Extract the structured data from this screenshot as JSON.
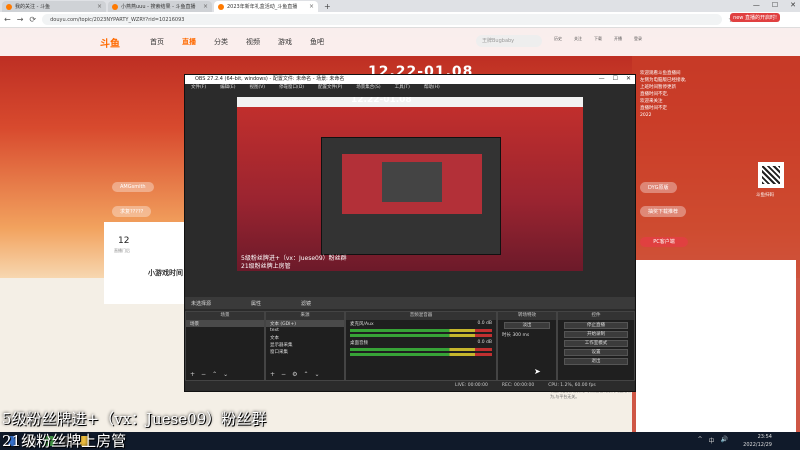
{
  "browser": {
    "tabs": [
      {
        "label": "我的关注 - 斗鱼",
        "active": false
      },
      {
        "label": "小燕燕uuu - 搜索结果 - 斗鱼直播",
        "active": false
      },
      {
        "label": "2023年新年礼盒活动_斗鱼直播",
        "active": true
      }
    ],
    "new_tab": "+",
    "url": "douyu.com/topic/2023NYPARTY_WZRY?rid=10216093",
    "login_hint": "new 直播的开启时!"
  },
  "site": {
    "logo": "斗鱼",
    "nav": [
      "首页",
      "直播",
      "分类",
      "视频",
      "游戏",
      "鱼吧"
    ],
    "active_nav": "直播",
    "search_placeholder": "王牌Bugbaby",
    "top_icons": [
      "历史",
      "关注",
      "下载",
      "开播",
      "登录"
    ],
    "banner_date": "12.22-01.08",
    "fans_count": "12",
    "fans_label": "直播门后",
    "streamer_name": "小游戏时间",
    "left_pills": [
      "AMGsmith",
      "求复?????"
    ],
    "right_pills": [
      "DYG原版",
      "抽奖下载推荐"
    ],
    "chat_lines": [
      "欢迎观看斗鱼直播间",
      "左侧为电脑版已经接收,",
      "上班时间暂停更新",
      "直播时间不定,",
      "欢迎来关注",
      "直播时间不定",
      "2022"
    ],
    "qr_label": "斗鱼扫码",
    "pc_button": "PC客户端",
    "right_note": "以上内容仅供娱乐参考,禁止任何形式的违法行为,与平台无关。"
  },
  "obs": {
    "title": "OBS 27.2.4 (64-bit, windows) - 配置文件: 未命名 - 场景: 未命名",
    "menu": [
      "文件(F)",
      "编辑(E)",
      "视图(V)",
      "停靠窗口(D)",
      "配置文件(P)",
      "场景集合(S)",
      "工具(T)",
      "帮助(H)"
    ],
    "preview_text_1": "5级粉丝牌进+（vx：Juese09）粉丝群",
    "preview_text_2": "21级粉丝牌上房管",
    "scene_bar_label": "未选择源",
    "scene_bar_props": "属性",
    "scene_bar_filters": "滤镜",
    "docks": {
      "scenes_header": "场景",
      "scenes": [
        "场景"
      ],
      "sources_header": "来源",
      "sources": [
        "文本 (GDI+)",
        "text",
        "文本",
        "显示器采集",
        "窗口采集"
      ],
      "mixer_header": "音频混音器",
      "mixer": [
        {
          "name": "桌面音频",
          "db": "0.0 dB"
        },
        {
          "name": "麦克风/Aux",
          "db": "0.0 dB"
        }
      ],
      "transitions_header": "转场特效",
      "transition_type": "淡出",
      "transition_duration": "300 ms",
      "transition_duration_label": "时长",
      "controls_header": "控件",
      "controls": [
        "停止直播",
        "开始录制",
        "工作室模式",
        "设置",
        "退出"
      ]
    },
    "status": {
      "live": "LIVE: 00:00:00",
      "rec": "REC: 00:00:00",
      "cpu": "CPU: 1.2%, 60.00 fps"
    }
  },
  "overlays": {
    "line1": "5级粉丝牌进+（vx：Juese09）粉丝群",
    "line2": "21级粉丝牌上房管"
  },
  "taskbar": {
    "time": "23:54",
    "date": "2022/12/29",
    "tray": [
      "^",
      "中",
      "🔊"
    ]
  }
}
